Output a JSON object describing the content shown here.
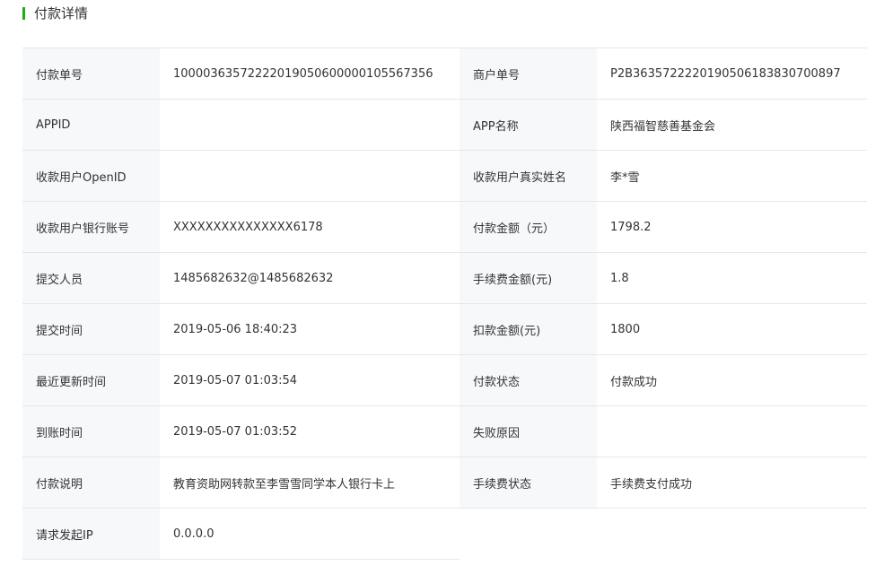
{
  "section": {
    "title": "付款详情",
    "accent_color": "#1aad19"
  },
  "rows": [
    {
      "l1": "付款单号",
      "v1": "10000363572222019050600000105567356",
      "l2": "商户单号",
      "v2": "P2B36357222201905061838307008​97"
    },
    {
      "l1": "APPID",
      "v1": "",
      "l2": "APP名称",
      "v2": "陕西福智慈善基金会"
    },
    {
      "l1": "收款用户OpenID",
      "v1": "",
      "l2": "收款用户真实姓名",
      "v2": "李*雪"
    },
    {
      "l1": "收款用户银行账号",
      "v1": "XXXXXXXXXXXXXXX6178",
      "l2": "付款金额（元）",
      "v2": "1798.2"
    },
    {
      "l1": "提交人员",
      "v1": "1485682632@1485682632",
      "l2": "手续费金额(元)",
      "v2": "1.8"
    },
    {
      "l1": "提交时间",
      "v1": "2019-05-06 18:40:23",
      "l2": "扣款金额(元)",
      "v2": "1800"
    },
    {
      "l1": "最近更新时间",
      "v1": "2019-05-07 01:03:54",
      "l2": "付款状态",
      "v2": "付款成功"
    },
    {
      "l1": "到账时间",
      "v1": "2019-05-07 01:03:52",
      "l2": "失败原因",
      "v2": ""
    },
    {
      "l1": "付款说明",
      "v1": "教育资助网转款至李雪雪同学本人银行卡上",
      "l2": "手续费状态",
      "v2": "手续费支付成功"
    }
  ],
  "last_row": {
    "l1": "请求发起IP",
    "v1": "0.0.0.0"
  }
}
